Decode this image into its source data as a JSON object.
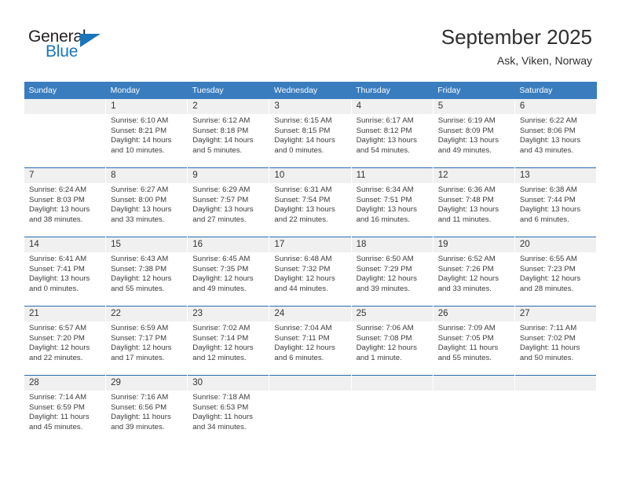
{
  "brand": {
    "name_part1": "General",
    "name_part2": "Blue",
    "logo_icon": "triangle-icon"
  },
  "header": {
    "title": "September 2025",
    "subtitle": "Ask, Viken, Norway"
  },
  "colors": {
    "header_blue": "#3a7dbf",
    "separator_blue": "#2c6cad",
    "daynum_bg": "#f0f0f0",
    "brand_blue": "#1b75bb",
    "text": "#3c3c3c"
  },
  "weekday_headers": [
    "Sunday",
    "Monday",
    "Tuesday",
    "Wednesday",
    "Thursday",
    "Friday",
    "Saturday"
  ],
  "weeks": [
    [
      {
        "day": "",
        "sunrise": "",
        "sunset": "",
        "daylight_l1": "",
        "daylight_l2": "",
        "empty": true
      },
      {
        "day": "1",
        "sunrise": "Sunrise: 6:10 AM",
        "sunset": "Sunset: 8:21 PM",
        "daylight_l1": "Daylight: 14 hours",
        "daylight_l2": "and 10 minutes."
      },
      {
        "day": "2",
        "sunrise": "Sunrise: 6:12 AM",
        "sunset": "Sunset: 8:18 PM",
        "daylight_l1": "Daylight: 14 hours",
        "daylight_l2": "and 5 minutes."
      },
      {
        "day": "3",
        "sunrise": "Sunrise: 6:15 AM",
        "sunset": "Sunset: 8:15 PM",
        "daylight_l1": "Daylight: 14 hours",
        "daylight_l2": "and 0 minutes."
      },
      {
        "day": "4",
        "sunrise": "Sunrise: 6:17 AM",
        "sunset": "Sunset: 8:12 PM",
        "daylight_l1": "Daylight: 13 hours",
        "daylight_l2": "and 54 minutes."
      },
      {
        "day": "5",
        "sunrise": "Sunrise: 6:19 AM",
        "sunset": "Sunset: 8:09 PM",
        "daylight_l1": "Daylight: 13 hours",
        "daylight_l2": "and 49 minutes."
      },
      {
        "day": "6",
        "sunrise": "Sunrise: 6:22 AM",
        "sunset": "Sunset: 8:06 PM",
        "daylight_l1": "Daylight: 13 hours",
        "daylight_l2": "and 43 minutes."
      }
    ],
    [
      {
        "day": "7",
        "sunrise": "Sunrise: 6:24 AM",
        "sunset": "Sunset: 8:03 PM",
        "daylight_l1": "Daylight: 13 hours",
        "daylight_l2": "and 38 minutes."
      },
      {
        "day": "8",
        "sunrise": "Sunrise: 6:27 AM",
        "sunset": "Sunset: 8:00 PM",
        "daylight_l1": "Daylight: 13 hours",
        "daylight_l2": "and 33 minutes."
      },
      {
        "day": "9",
        "sunrise": "Sunrise: 6:29 AM",
        "sunset": "Sunset: 7:57 PM",
        "daylight_l1": "Daylight: 13 hours",
        "daylight_l2": "and 27 minutes."
      },
      {
        "day": "10",
        "sunrise": "Sunrise: 6:31 AM",
        "sunset": "Sunset: 7:54 PM",
        "daylight_l1": "Daylight: 13 hours",
        "daylight_l2": "and 22 minutes."
      },
      {
        "day": "11",
        "sunrise": "Sunrise: 6:34 AM",
        "sunset": "Sunset: 7:51 PM",
        "daylight_l1": "Daylight: 13 hours",
        "daylight_l2": "and 16 minutes."
      },
      {
        "day": "12",
        "sunrise": "Sunrise: 6:36 AM",
        "sunset": "Sunset: 7:48 PM",
        "daylight_l1": "Daylight: 13 hours",
        "daylight_l2": "and 11 minutes."
      },
      {
        "day": "13",
        "sunrise": "Sunrise: 6:38 AM",
        "sunset": "Sunset: 7:44 PM",
        "daylight_l1": "Daylight: 13 hours",
        "daylight_l2": "and 6 minutes."
      }
    ],
    [
      {
        "day": "14",
        "sunrise": "Sunrise: 6:41 AM",
        "sunset": "Sunset: 7:41 PM",
        "daylight_l1": "Daylight: 13 hours",
        "daylight_l2": "and 0 minutes."
      },
      {
        "day": "15",
        "sunrise": "Sunrise: 6:43 AM",
        "sunset": "Sunset: 7:38 PM",
        "daylight_l1": "Daylight: 12 hours",
        "daylight_l2": "and 55 minutes."
      },
      {
        "day": "16",
        "sunrise": "Sunrise: 6:45 AM",
        "sunset": "Sunset: 7:35 PM",
        "daylight_l1": "Daylight: 12 hours",
        "daylight_l2": "and 49 minutes."
      },
      {
        "day": "17",
        "sunrise": "Sunrise: 6:48 AM",
        "sunset": "Sunset: 7:32 PM",
        "daylight_l1": "Daylight: 12 hours",
        "daylight_l2": "and 44 minutes."
      },
      {
        "day": "18",
        "sunrise": "Sunrise: 6:50 AM",
        "sunset": "Sunset: 7:29 PM",
        "daylight_l1": "Daylight: 12 hours",
        "daylight_l2": "and 39 minutes."
      },
      {
        "day": "19",
        "sunrise": "Sunrise: 6:52 AM",
        "sunset": "Sunset: 7:26 PM",
        "daylight_l1": "Daylight: 12 hours",
        "daylight_l2": "and 33 minutes."
      },
      {
        "day": "20",
        "sunrise": "Sunrise: 6:55 AM",
        "sunset": "Sunset: 7:23 PM",
        "daylight_l1": "Daylight: 12 hours",
        "daylight_l2": "and 28 minutes."
      }
    ],
    [
      {
        "day": "21",
        "sunrise": "Sunrise: 6:57 AM",
        "sunset": "Sunset: 7:20 PM",
        "daylight_l1": "Daylight: 12 hours",
        "daylight_l2": "and 22 minutes."
      },
      {
        "day": "22",
        "sunrise": "Sunrise: 6:59 AM",
        "sunset": "Sunset: 7:17 PM",
        "daylight_l1": "Daylight: 12 hours",
        "daylight_l2": "and 17 minutes."
      },
      {
        "day": "23",
        "sunrise": "Sunrise: 7:02 AM",
        "sunset": "Sunset: 7:14 PM",
        "daylight_l1": "Daylight: 12 hours",
        "daylight_l2": "and 12 minutes."
      },
      {
        "day": "24",
        "sunrise": "Sunrise: 7:04 AM",
        "sunset": "Sunset: 7:11 PM",
        "daylight_l1": "Daylight: 12 hours",
        "daylight_l2": "and 6 minutes."
      },
      {
        "day": "25",
        "sunrise": "Sunrise: 7:06 AM",
        "sunset": "Sunset: 7:08 PM",
        "daylight_l1": "Daylight: 12 hours",
        "daylight_l2": "and 1 minute."
      },
      {
        "day": "26",
        "sunrise": "Sunrise: 7:09 AM",
        "sunset": "Sunset: 7:05 PM",
        "daylight_l1": "Daylight: 11 hours",
        "daylight_l2": "and 55 minutes."
      },
      {
        "day": "27",
        "sunrise": "Sunrise: 7:11 AM",
        "sunset": "Sunset: 7:02 PM",
        "daylight_l1": "Daylight: 11 hours",
        "daylight_l2": "and 50 minutes."
      }
    ],
    [
      {
        "day": "28",
        "sunrise": "Sunrise: 7:14 AM",
        "sunset": "Sunset: 6:59 PM",
        "daylight_l1": "Daylight: 11 hours",
        "daylight_l2": "and 45 minutes."
      },
      {
        "day": "29",
        "sunrise": "Sunrise: 7:16 AM",
        "sunset": "Sunset: 6:56 PM",
        "daylight_l1": "Daylight: 11 hours",
        "daylight_l2": "and 39 minutes."
      },
      {
        "day": "30",
        "sunrise": "Sunrise: 7:18 AM",
        "sunset": "Sunset: 6:53 PM",
        "daylight_l1": "Daylight: 11 hours",
        "daylight_l2": "and 34 minutes."
      },
      {
        "day": "",
        "sunrise": "",
        "sunset": "",
        "daylight_l1": "",
        "daylight_l2": "",
        "empty": true
      },
      {
        "day": "",
        "sunrise": "",
        "sunset": "",
        "daylight_l1": "",
        "daylight_l2": "",
        "empty": true
      },
      {
        "day": "",
        "sunrise": "",
        "sunset": "",
        "daylight_l1": "",
        "daylight_l2": "",
        "empty": true
      },
      {
        "day": "",
        "sunrise": "",
        "sunset": "",
        "daylight_l1": "",
        "daylight_l2": "",
        "empty": true
      }
    ]
  ]
}
